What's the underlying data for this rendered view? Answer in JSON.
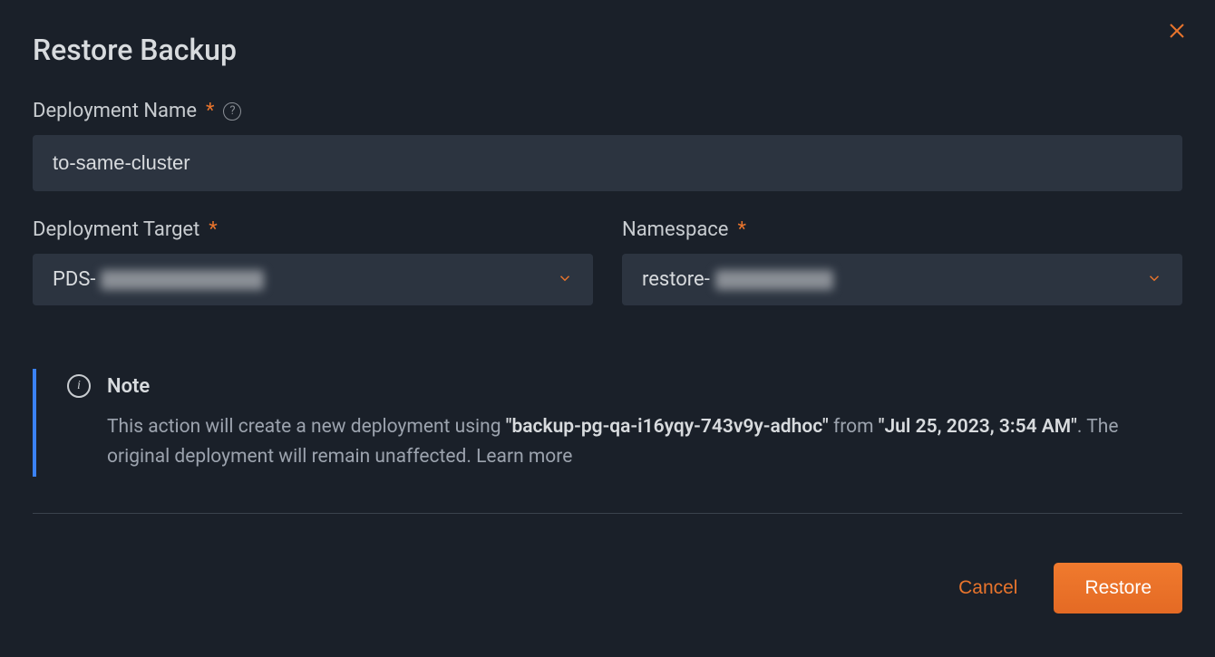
{
  "modal": {
    "title": "Restore Backup",
    "deployment_name": {
      "label": "Deployment Name",
      "value": "to-same-cluster"
    },
    "deployment_target": {
      "label": "Deployment Target",
      "value_prefix": "PDS-"
    },
    "namespace": {
      "label": "Namespace",
      "value_prefix": "restore-"
    },
    "note": {
      "title": "Note",
      "text_prefix": "This action will create a new deployment using ",
      "backup_name": "\"backup-pg-qa-i16yqy-743v9y-adhoc\"",
      "text_mid": " from ",
      "backup_time": "\"Jul 25, 2023, 3:54 AM\"",
      "text_suffix": ". The original deployment will remain unaffected. ",
      "learn_more": "Learn more"
    },
    "footer": {
      "cancel": "Cancel",
      "restore": "Restore"
    }
  }
}
